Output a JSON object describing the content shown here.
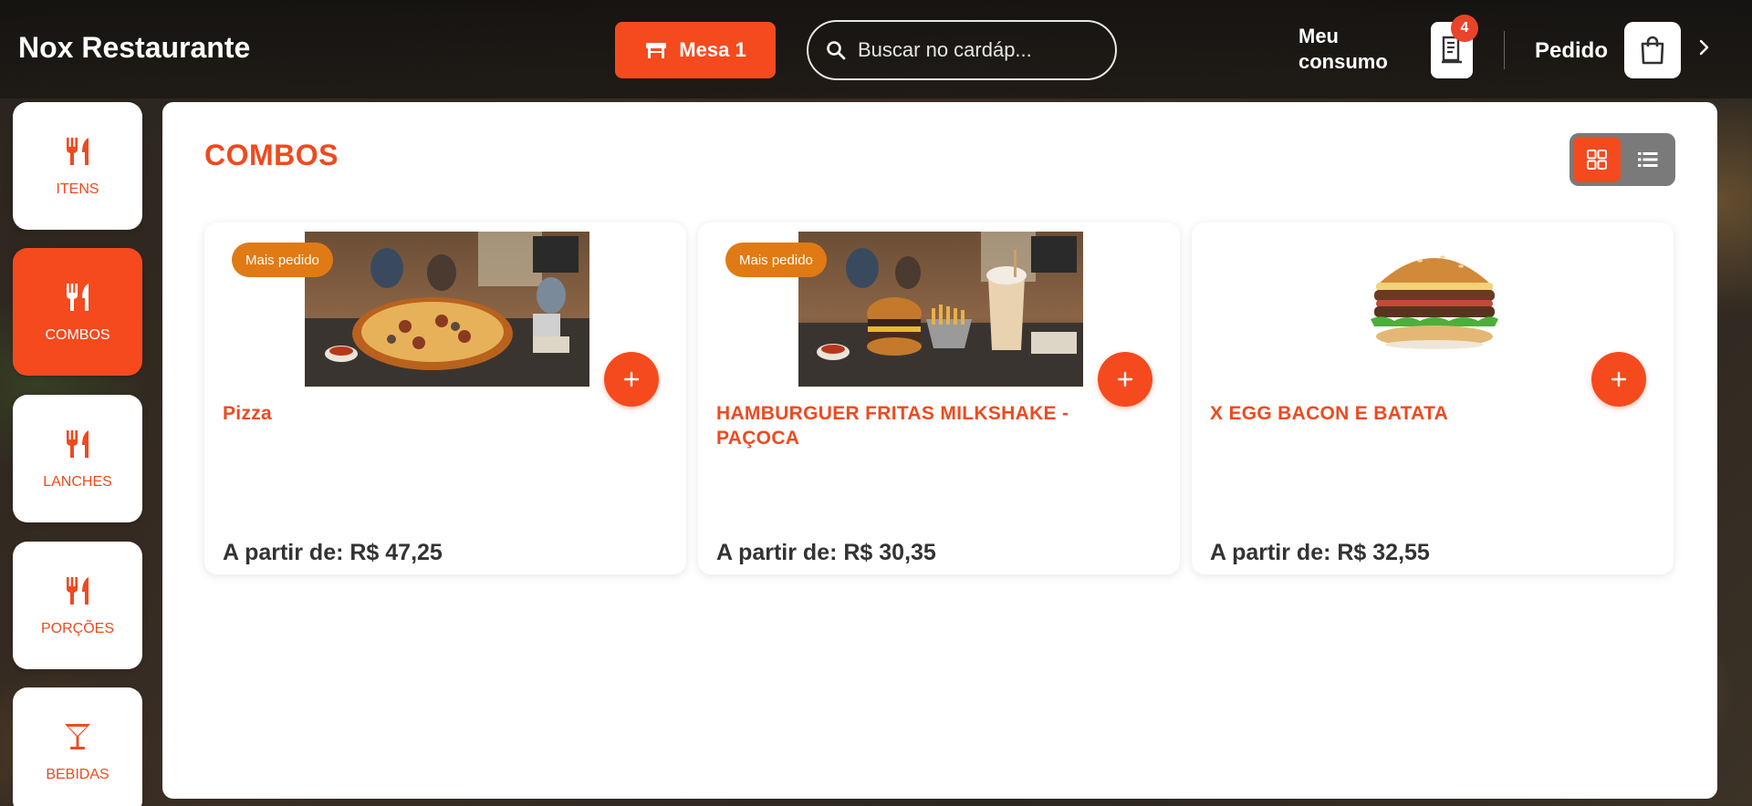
{
  "header": {
    "brand": "Nox Restaurante",
    "table_button": "Mesa 1",
    "search_placeholder": "Buscar no cardáp...",
    "consumo_label": "Meu consumo",
    "consumo_badge": "4",
    "pedido_label": "Pedido"
  },
  "sidebar": {
    "items": [
      {
        "label": "ITENS",
        "icon": "utensils-icon"
      },
      {
        "label": "COMBOS",
        "icon": "utensils-icon"
      },
      {
        "label": "LANCHES",
        "icon": "utensils-icon"
      },
      {
        "label": "PORÇÕES",
        "icon": "utensils-icon"
      },
      {
        "label": "BEBIDAS",
        "icon": "cocktail-icon"
      }
    ],
    "active": "COMBOS"
  },
  "main": {
    "section_title": "COMBOS",
    "view_modes": [
      "grid-view",
      "list-view"
    ],
    "active_view": "grid-view",
    "products": [
      {
        "tag": "Mais pedido",
        "name": "Pizza",
        "price": "A partir de: R$ 47,25",
        "image": "pizza"
      },
      {
        "tag": "Mais pedido",
        "name": "HAMBURGUER FRITAS MILKSHAKE - PAÇOCA",
        "price": "A partir de: R$ 30,35",
        "image": "burger-fries-milkshake"
      },
      {
        "tag": "",
        "name": "X EGG BACON E BATATA",
        "price": "A partir de: R$ 32,55",
        "image": "burger"
      }
    ]
  },
  "colors": {
    "accent": "#f54a1e",
    "accent_text": "#ef4a1f",
    "tag": "#e07a14",
    "badge": "#e8442a"
  }
}
